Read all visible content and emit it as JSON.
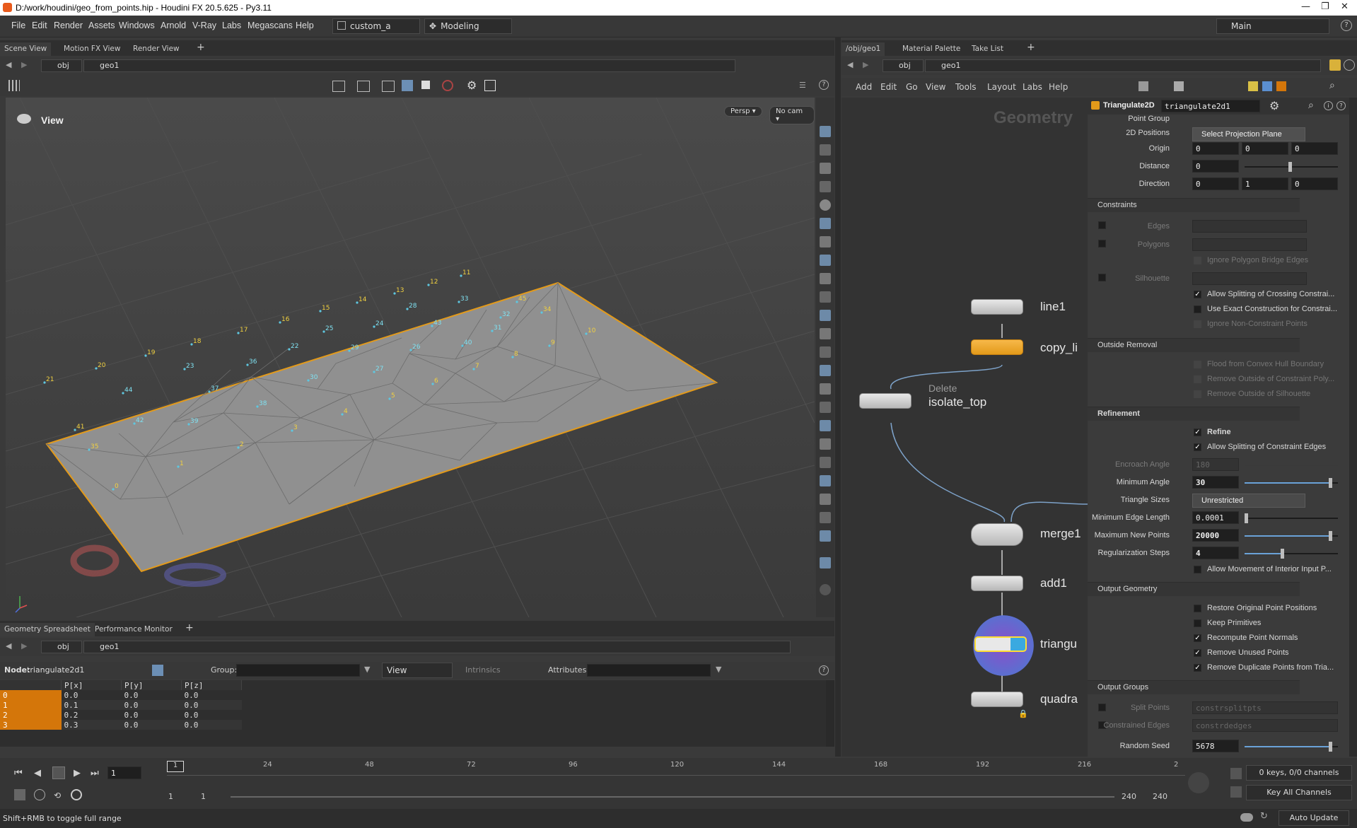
{
  "window": {
    "title": "D:/work/houdini/geo_from_points.hip - Houdini FX 20.5.625 - Py3.11",
    "controls": [
      "—",
      "❐",
      "✕"
    ]
  },
  "menu": {
    "items": [
      "File",
      "Edit",
      "Render",
      "Assets",
      "Windows",
      "Arnold",
      "V-Ray",
      "Labs",
      "Megascans",
      "Help"
    ],
    "desktop": "custom_a",
    "shelf_set": "Modeling",
    "main_label": "Main"
  },
  "scene_panel": {
    "tabs": [
      "Scene View",
      "Motion FX View",
      "Render View"
    ],
    "path": [
      "obj",
      "geo1"
    ],
    "view_label": "View",
    "persp": "Persp ▾",
    "cam": "No cam ▾"
  },
  "viewport": {
    "boundary_labels": [
      {
        "t": "0"
      },
      {
        "t": "1"
      },
      {
        "t": "2"
      },
      {
        "t": "3"
      },
      {
        "t": "4"
      },
      {
        "t": "5"
      },
      {
        "t": "6"
      },
      {
        "t": "7"
      },
      {
        "t": "8"
      },
      {
        "t": "9"
      },
      {
        "t": "10"
      },
      {
        "t": "11"
      },
      {
        "t": "12"
      },
      {
        "t": "13"
      },
      {
        "t": "14"
      },
      {
        "t": "15"
      },
      {
        "t": "16"
      },
      {
        "t": "17"
      },
      {
        "t": "18"
      },
      {
        "t": "19"
      },
      {
        "t": "20"
      },
      {
        "t": "21"
      },
      {
        "t": "35"
      },
      {
        "t": "41"
      },
      {
        "t": "45"
      },
      {
        "t": "34"
      }
    ],
    "interior_labels": [
      {
        "t": "44"
      },
      {
        "t": "37"
      },
      {
        "t": "36"
      },
      {
        "t": "23"
      },
      {
        "t": "22"
      },
      {
        "t": "25"
      },
      {
        "t": "29"
      },
      {
        "t": "24"
      },
      {
        "t": "28"
      },
      {
        "t": "33"
      },
      {
        "t": "43"
      },
      {
        "t": "32"
      },
      {
        "t": "31"
      },
      {
        "t": "40"
      },
      {
        "t": "26"
      },
      {
        "t": "27"
      },
      {
        "t": "30"
      },
      {
        "t": "38"
      },
      {
        "t": "39"
      },
      {
        "t": "42"
      }
    ],
    "axis_tags": [
      "x",
      "y",
      "z"
    ]
  },
  "spreadsheet": {
    "tabs": [
      "Geometry Spreadsheet",
      "Performance Monitor"
    ],
    "path": [
      "obj",
      "geo1"
    ],
    "node_label": "Node:",
    "node_value": "triangulate2d1",
    "group_label": "Group:",
    "view_label": "View",
    "intrinsics_label": "Intrinsics",
    "attributes_label": "Attributes:",
    "columns": [
      "",
      "P[x]",
      "P[y]",
      "P[z]"
    ],
    "rows": [
      {
        "idx": "0",
        "x": "0.0",
        "y": "0.0",
        "z": "0.0"
      },
      {
        "idx": "1",
        "x": "0.1",
        "y": "0.0",
        "z": "0.0"
      },
      {
        "idx": "2",
        "x": "0.2",
        "y": "0.0",
        "z": "0.0"
      },
      {
        "idx": "3",
        "x": "0.3",
        "y": "0.0",
        "z": "0.0"
      }
    ]
  },
  "network": {
    "tabs": [
      "/obj/geo1",
      "Material Palette",
      "Take List"
    ],
    "path": [
      "obj",
      "geo1"
    ],
    "menu": [
      "Add",
      "Edit",
      "Go",
      "View",
      "Tools",
      "Layout",
      "Labs",
      "Help"
    ],
    "context_label": "Geometry",
    "nodes": {
      "line1": "line1",
      "copy": "copy_li",
      "delete_type": "Delete",
      "delete_name": "isolate_top",
      "merge": "merge1",
      "add": "add1",
      "tri": "triangu",
      "quad": "quadra"
    }
  },
  "params": {
    "node_type": "Triangulate2D",
    "node_name": "triangulate2d1",
    "cut_top_label": "Point Group",
    "positions_label": "2D Positions",
    "positions_value": "Select Projection Plane",
    "origin_label": "Origin",
    "origin": [
      "0",
      "0",
      "0"
    ],
    "distance_label": "Distance",
    "distance": "0",
    "direction_label": "Direction",
    "direction": [
      "0",
      "1",
      "0"
    ],
    "constraints": {
      "title": "Constraints",
      "edges": "Edges",
      "polygons": "Polygons",
      "ignore_bridge": "Ignore Polygon Bridge Edges",
      "silhouette": "Silhouette",
      "allow_split": "Allow Splitting of Crossing Constrai...",
      "exact": "Use Exact Construction for Constrai...",
      "ignore_non": "Ignore Non-Constraint Points"
    },
    "outside": {
      "title": "Outside Removal",
      "flood": "Flood from Convex Hull Boundary",
      "remove_poly": "Remove Outside of Constraint Poly...",
      "remove_sil": "Remove Outside of Silhouette"
    },
    "refinement": {
      "title": "Refinement",
      "refine": "Refine",
      "allow_split_edges": "Allow Splitting of Constraint Edges",
      "encroach_label": "Encroach Angle",
      "encroach": "180",
      "min_angle_label": "Minimum Angle",
      "min_angle": "30",
      "tri_sizes_label": "Triangle Sizes",
      "tri_sizes": "Unrestricted",
      "min_edge_label": "Minimum Edge Length",
      "min_edge": "0.0001",
      "max_points_label": "Maximum New Points",
      "max_points": "20000",
      "reg_label": "Regularization Steps",
      "reg": "4",
      "allow_move": "Allow Movement of Interior Input P..."
    },
    "output_geo": {
      "title": "Output Geometry",
      "restore": "Restore Original Point Positions",
      "keep_prims": "Keep Primitives",
      "recompute": "Recompute Point Normals",
      "remove_unused": "Remove Unused Points",
      "remove_dup": "Remove Duplicate Points from Tria..."
    },
    "output_groups": {
      "title": "Output Groups",
      "split_label": "Split Points",
      "split_value": "constrsplitpts",
      "constrained_label": "Constrained Edges",
      "constrained_value": "constrdedges",
      "seed_label": "Random Seed",
      "seed": "5678"
    },
    "min_angle_level": 0.92,
    "max_points_level": 0.92,
    "reg_level": 0.4,
    "seed_level": 0.92
  },
  "timeline": {
    "current_frame": "1",
    "frame_box": "1",
    "ticks": [
      "24",
      "48",
      "72",
      "96",
      "120",
      "144",
      "168",
      "192",
      "216",
      "2"
    ],
    "range_start": "1",
    "range_start2": "1",
    "range_end": "240",
    "range_end2": "240",
    "keys_label": "0 keys, 0/0 channels",
    "key_all": "Key All Channels"
  },
  "status": {
    "hint": "Shift+RMB to toggle full range",
    "auto_update": "Auto Update"
  },
  "colors": {
    "selected_node": "#f5a623",
    "row_index": "#d4760a",
    "accent": "#ffdd33"
  }
}
